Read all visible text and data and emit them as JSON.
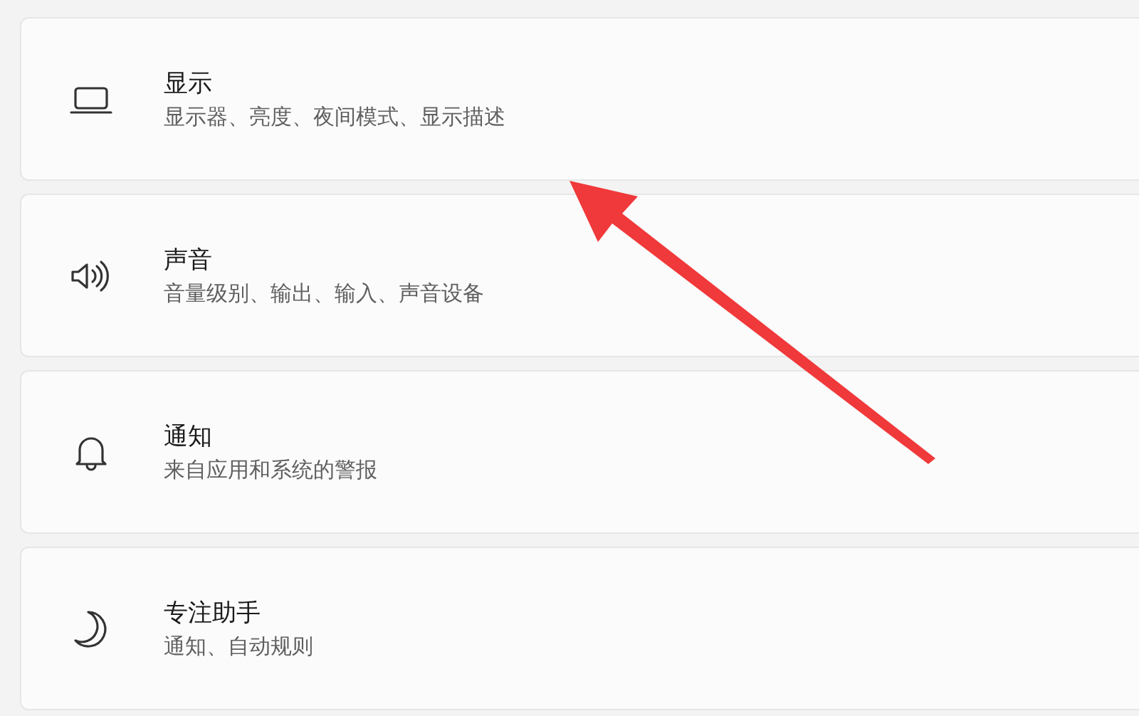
{
  "settings": [
    {
      "kind": "display",
      "title": "显示",
      "subtitle": "显示器、亮度、夜间模式、显示描述"
    },
    {
      "kind": "sound",
      "title": "声音",
      "subtitle": "音量级别、输出、输入、声音设备"
    },
    {
      "kind": "notifications",
      "title": "通知",
      "subtitle": "来自应用和系统的警报"
    },
    {
      "kind": "focus",
      "title": "专注助手",
      "subtitle": "通知、自动规则"
    }
  ]
}
